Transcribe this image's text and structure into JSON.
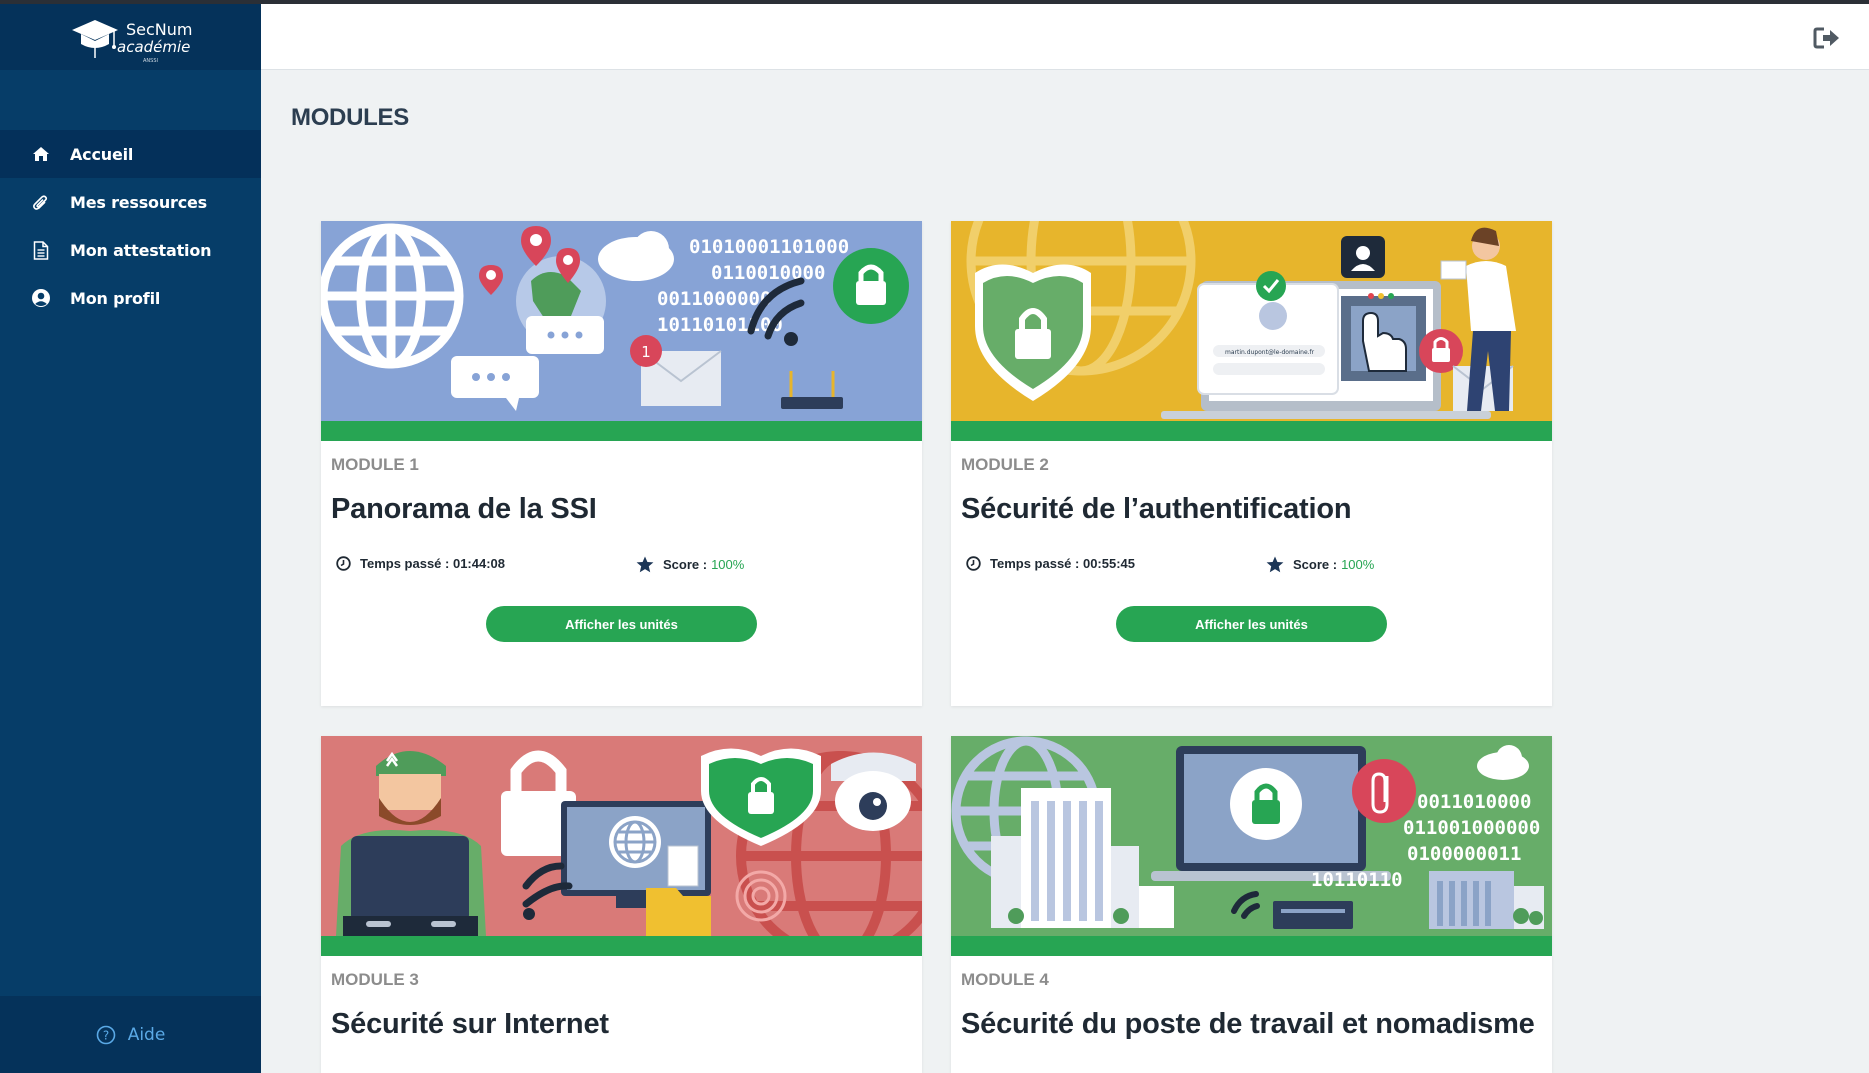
{
  "brand": {
    "name": "SecNum",
    "subtitle": "académie",
    "tagline": "ANSSI"
  },
  "sidebar": {
    "items": [
      {
        "label": "Accueil",
        "icon": "home-icon",
        "active": true
      },
      {
        "label": "Mes ressources",
        "icon": "paperclip-icon",
        "active": false
      },
      {
        "label": "Mon attestation",
        "icon": "document-icon",
        "active": false
      },
      {
        "label": "Mon profil",
        "icon": "user-circle-icon",
        "active": false
      }
    ],
    "help_label": "Aide"
  },
  "header": {
    "logout_icon": "logout-icon"
  },
  "page": {
    "title": "MODULES"
  },
  "modules": [
    {
      "number": "MODULE 1",
      "title": "Panorama de la SSI",
      "time_label": "Temps passé : 01:44:08",
      "score_label": "Score :",
      "score_value": "100%",
      "button": "Afficher les unités",
      "banner_color": "#87a3d6"
    },
    {
      "number": "MODULE 2",
      "title": "Sécurité de l’authentification",
      "time_label": "Temps passé : 00:55:45",
      "score_label": "Score :",
      "score_value": "100%",
      "button": "Afficher les unités",
      "banner_color": "#e7b52c"
    },
    {
      "number": "MODULE 3",
      "title": "Sécurité sur Internet",
      "banner_color": "#d97a78"
    },
    {
      "number": "MODULE 4",
      "title": "Sécurité du poste de travail et nomadisme",
      "banner_color": "#67ad69"
    }
  ],
  "banner_texts": {
    "m1_binary": [
      "01010001101000",
      "0110010000",
      "0011000000",
      "10110101100"
    ],
    "m1_notif": "1",
    "m2_email": "martin.dupont@le-domaine.fr",
    "m4_binary": [
      "0011010000",
      "011001000000",
      "0100000011",
      "10110110"
    ]
  },
  "colors": {
    "accent": "#27a553",
    "sidebar": "#063d68",
    "help": "#5aa9e6"
  }
}
